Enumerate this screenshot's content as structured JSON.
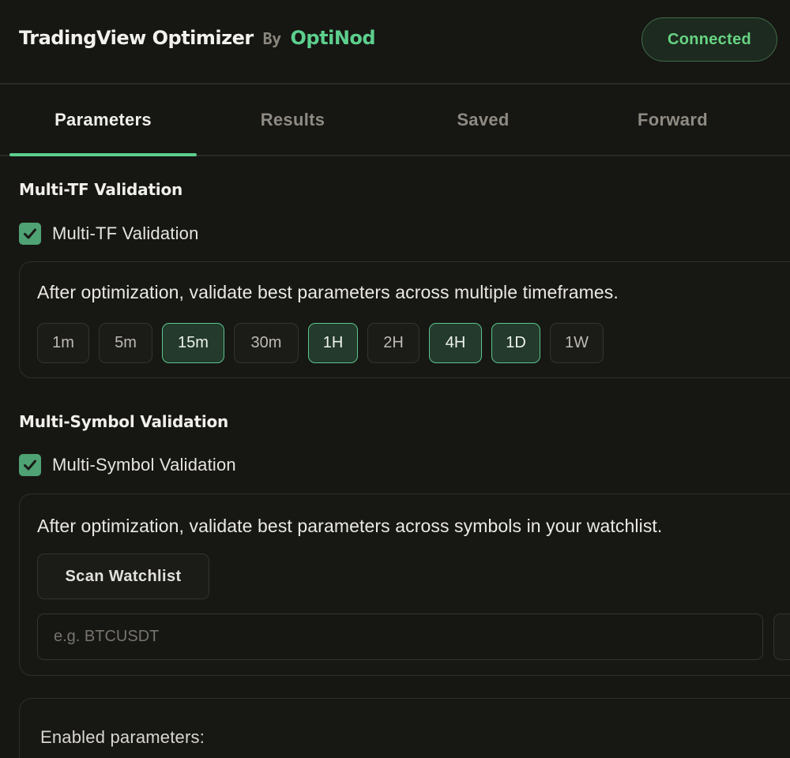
{
  "header": {
    "app_name": "TradingView Optimizer",
    "by": "By",
    "company": "OptiNod",
    "status": "Connected"
  },
  "tabs": [
    {
      "label": "Parameters",
      "active": true
    },
    {
      "label": "Results",
      "active": false
    },
    {
      "label": "Saved",
      "active": false
    },
    {
      "label": "Forward",
      "active": false
    }
  ],
  "multi_tf": {
    "section_title": "Multi-TF Validation",
    "checkbox_label": "Multi-TF Validation",
    "checked": true,
    "description": "After optimization, validate best parameters across multiple timeframes.",
    "timeframes": [
      {
        "label": "1m",
        "selected": false
      },
      {
        "label": "5m",
        "selected": false
      },
      {
        "label": "15m",
        "selected": true
      },
      {
        "label": "30m",
        "selected": false
      },
      {
        "label": "1H",
        "selected": true
      },
      {
        "label": "2H",
        "selected": false
      },
      {
        "label": "4H",
        "selected": true
      },
      {
        "label": "1D",
        "selected": true
      },
      {
        "label": "1W",
        "selected": false
      }
    ]
  },
  "multi_symbol": {
    "section_title": "Multi-Symbol Validation",
    "checkbox_label": "Multi-Symbol Validation",
    "checked": true,
    "description": "After optimization, validate best parameters across symbols in your watchlist.",
    "scan_button": "Scan Watchlist",
    "symbol_input_value": "",
    "symbol_input_placeholder": "e.g. BTCUSDT"
  },
  "enabled_parameters": {
    "label": "Enabled parameters:"
  },
  "colors": {
    "accent": "#5ccf8d",
    "background": "#161613",
    "checkbox": "#4fa273",
    "status_text": "#67d483"
  },
  "icons": {
    "checkbox_checked": "checkmark-icon"
  }
}
